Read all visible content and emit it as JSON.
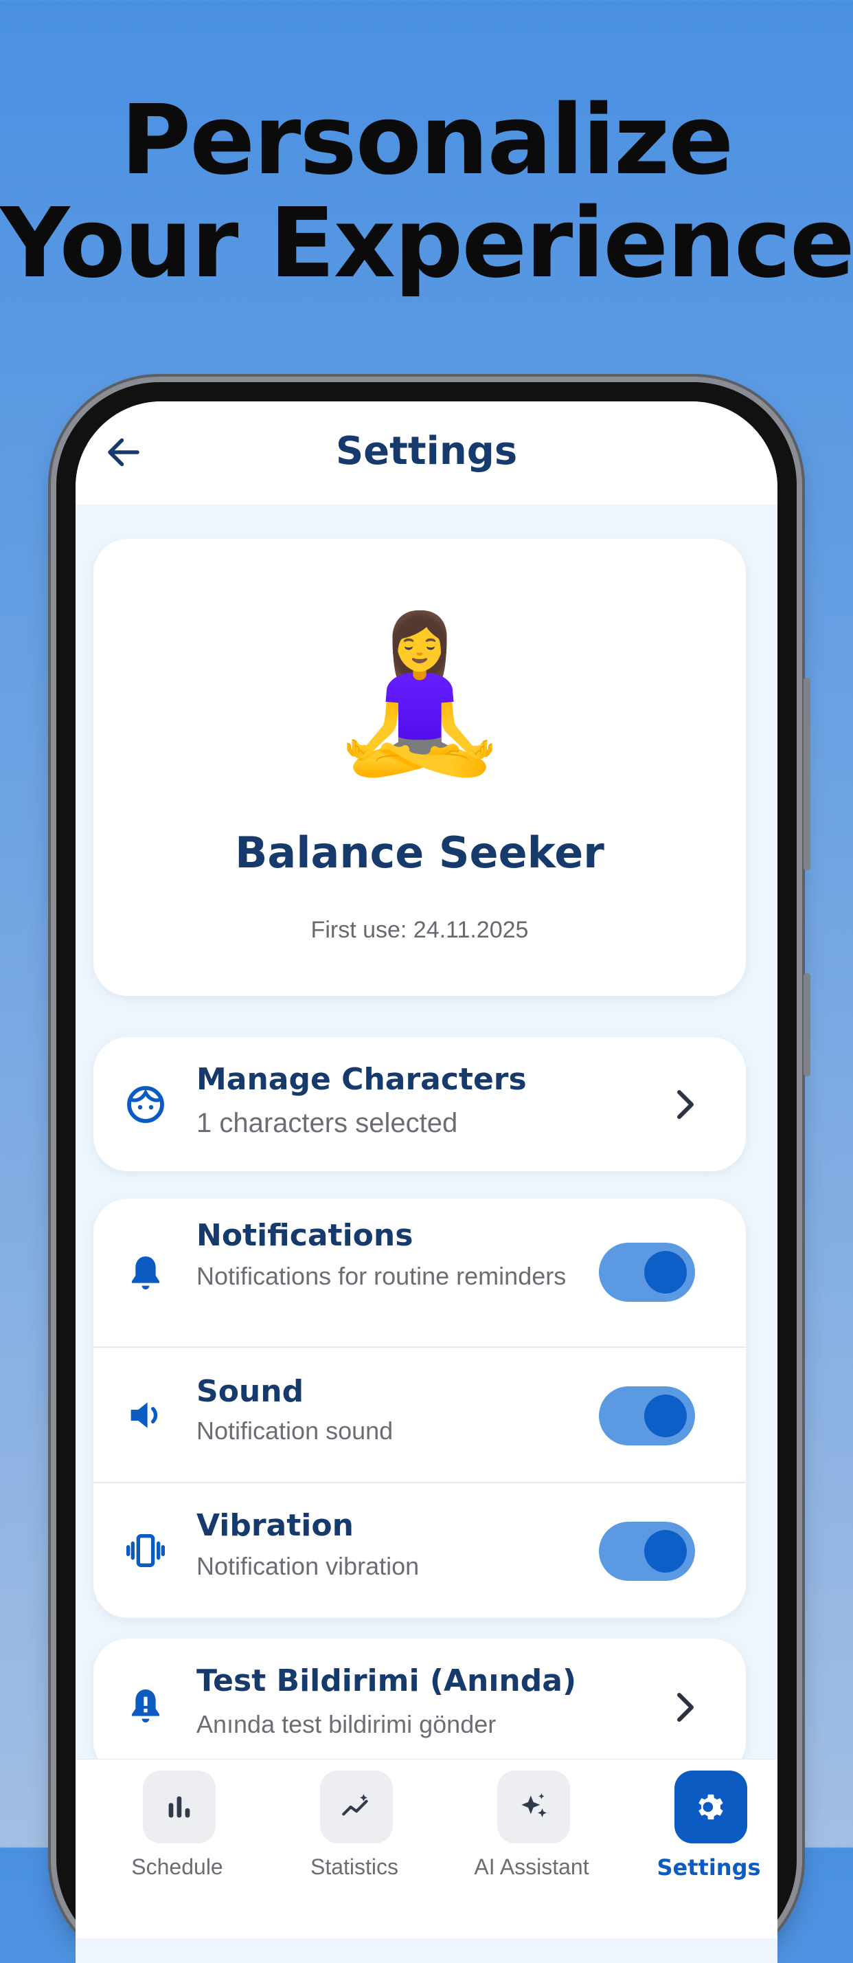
{
  "headline": {
    "line1": "Personalize",
    "line2": "Your Experience"
  },
  "header": {
    "title": "Settings"
  },
  "profile": {
    "emoji": "🧘‍♀️",
    "name": "Balance Seeker",
    "first_use": "First use: 24.11.2025"
  },
  "manage_characters": {
    "title": "Manage Characters",
    "subtitle": "1 characters selected"
  },
  "settings_group": [
    {
      "title": "Notifications",
      "subtitle": "Notifications for routine reminders",
      "enabled": true
    },
    {
      "title": "Sound",
      "subtitle": "Notification sound",
      "enabled": true
    },
    {
      "title": "Vibration",
      "subtitle": "Notification vibration",
      "enabled": true
    }
  ],
  "test_notification": {
    "title": "Test Bildirimi (Anında)",
    "subtitle": "Anında test bildirimi gönder"
  },
  "nav": [
    {
      "label": "Schedule",
      "icon": "bar-chart-icon"
    },
    {
      "label": "Statistics",
      "icon": "trend-sparkle-icon"
    },
    {
      "label": "AI Assistant",
      "icon": "sparkles-icon"
    },
    {
      "label": "Settings",
      "icon": "gear-icon",
      "active": true
    }
  ],
  "colors": {
    "accent": "#0b5bc2",
    "title": "#163a6b",
    "toggle_track": "#5b9ae3"
  }
}
